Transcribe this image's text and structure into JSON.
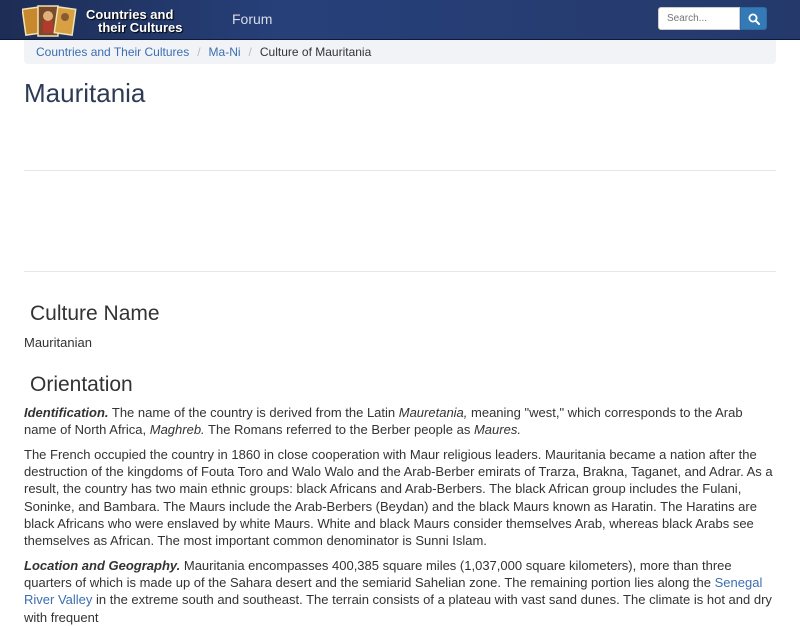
{
  "header": {
    "logo_line1": "Countries and",
    "logo_line2": "their Cultures",
    "forum_label": "Forum",
    "search_placeholder": "Search..."
  },
  "breadcrumb": {
    "items": [
      "Countries and Their Cultures",
      "Ma-Ni"
    ],
    "current": "Culture of Mauritania"
  },
  "page_title": "Mauritania",
  "sections": {
    "culture_name": {
      "heading": "Culture Name",
      "text": "Mauritanian"
    },
    "orientation": {
      "heading": "Orientation",
      "identification": {
        "label": "Identification.",
        "t1": " The name of the country is derived from the Latin ",
        "i1": "Mauretania,",
        "t2": " meaning \"west,\" which corresponds to the Arab name of North Africa, ",
        "i2": "Maghreb.",
        "t3": " The Romans referred to the Berber people as ",
        "i3": "Maures."
      },
      "french_paragraph": "The French occupied the country in 1860 in close cooperation with Maur religious leaders. Mauritania became a nation after the destruction of the kingdoms of Fouta Toro and Walo Walo and the Arab-Berber emirats of Trarza, Brakna, Taganet, and Adrar. As a result, the country has two main ethnic groups: black Africans and Arab-Berbers. The black African group includes the Fulani, Soninke, and Bambara. The Maurs include the Arab-Berbers (Beydan) and the black Maurs known as Haratin. The Haratins are black Africans who were enslaved by white Maurs. White and black Maurs consider themselves Arab, whereas black Arabs see themselves as African. The most important common denominator is Sunni Islam.",
      "location": {
        "label": "Location and Geography.",
        "t1": " Mauritania encompasses 400,385 square miles (1,037,000 square kilometers), more than three quarters of which is made up of the Sahara desert and the semiarid Sahelian zone. The remaining portion lies along the ",
        "link": "Senegal River Valley",
        "t2": " in the extreme south and southeast. The terrain consists of a plateau with vast sand dunes. The climate is hot and dry with frequent"
      }
    }
  },
  "colors": {
    "navbar": "#27407a",
    "link": "#3a6fb0",
    "search_button": "#337ab7"
  },
  "icons": {
    "logo": "countries-logo",
    "search": "search-icon"
  }
}
